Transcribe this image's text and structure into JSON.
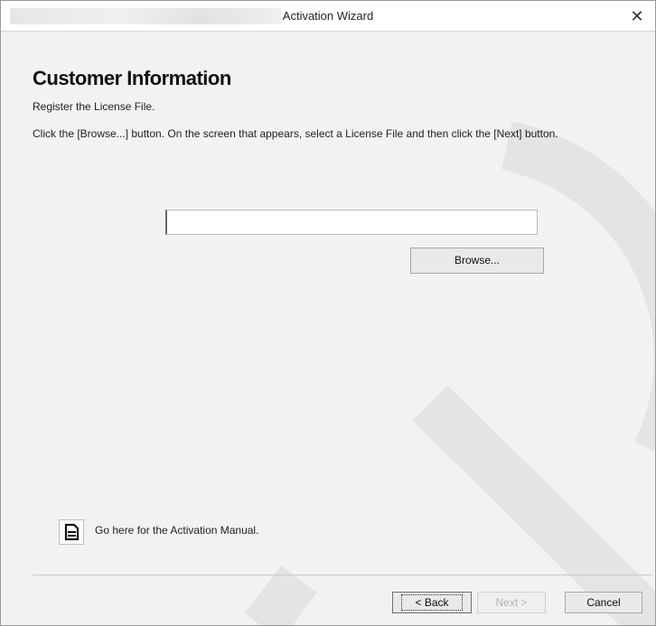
{
  "window": {
    "title": "Activation Wizard"
  },
  "page": {
    "heading": "Customer Information",
    "subtitle": "Register the License File.",
    "instruction": "Click the [Browse...] button. On the screen that appears, select a License File and then click the [Next] button."
  },
  "license_file": {
    "value": "",
    "browse_label": "Browse..."
  },
  "manual": {
    "icon": "document-icon",
    "link_text": "Go here for the Activation Manual."
  },
  "footer": {
    "back_label": "< Back",
    "next_label": "Next >",
    "cancel_label": "Cancel"
  },
  "colors": {
    "window_bg": "#f2f2f2",
    "titlebar_bg": "#ffffff",
    "disabled_text": "#b3b3b3"
  }
}
